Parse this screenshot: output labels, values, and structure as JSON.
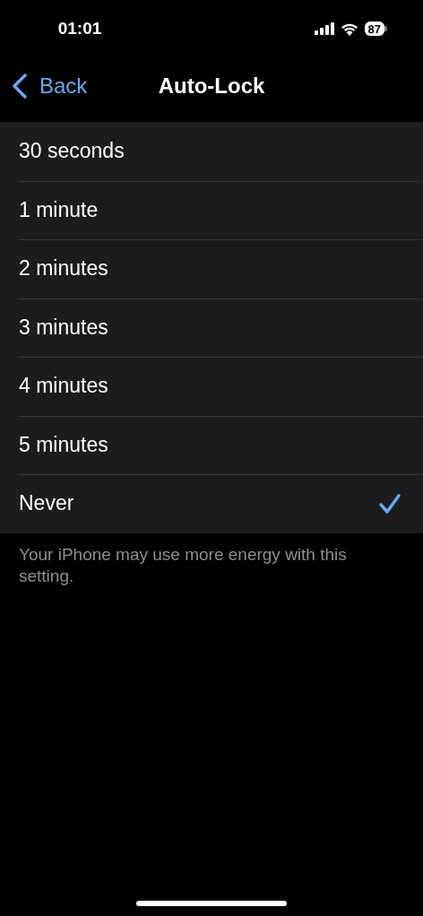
{
  "status_bar": {
    "time": "01:01",
    "battery": "87"
  },
  "nav": {
    "back": "Back",
    "title": "Auto-Lock"
  },
  "options": [
    {
      "label": "30 seconds",
      "selected": false
    },
    {
      "label": "1 minute",
      "selected": false
    },
    {
      "label": "2 minutes",
      "selected": false
    },
    {
      "label": "3 minutes",
      "selected": false
    },
    {
      "label": "4 minutes",
      "selected": false
    },
    {
      "label": "5 minutes",
      "selected": false
    },
    {
      "label": "Never",
      "selected": true
    }
  ],
  "footer": "Your iPhone may use more energy with this setting."
}
